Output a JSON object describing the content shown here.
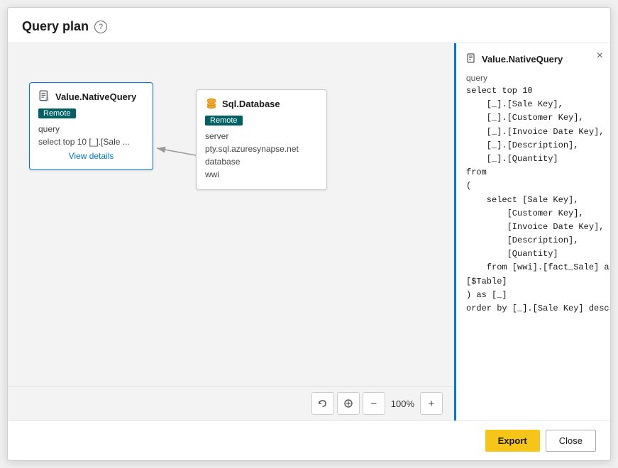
{
  "modal": {
    "title": "Query plan",
    "help_icon": "?"
  },
  "nodes": {
    "left": {
      "title": "Value.NativeQuery",
      "badge": "Remote",
      "query_label": "query",
      "query_preview": "select top 10 [_].[Sale ...",
      "link_label": "View details"
    },
    "right": {
      "title": "Sql.Database",
      "badge": "Remote",
      "server_label": "server",
      "server_value": "pty.sql.azuresynapse.net",
      "database_label": "database",
      "database_value": "wwi"
    }
  },
  "details_panel": {
    "title": "Value.NativeQuery",
    "close_icon": "×",
    "query_label": "query",
    "query_code": "select top 10\n    [_].[Sale Key],\n    [_].[Customer Key],\n    [_].[Invoice Date Key],\n    [_].[Description],\n    [_].[Quantity]\nfrom\n(\n    select [Sale Key],\n        [Customer Key],\n        [Invoice Date Key],\n        [Description],\n        [Quantity]\n    from [wwi].[fact_Sale] as\n[$Table]\n) as [_]\norder by [_].[Sale Key] desc"
  },
  "toolbar": {
    "zoom_level": "100%",
    "minus_label": "−",
    "plus_label": "+",
    "export_label": "Export",
    "close_label": "Close"
  }
}
